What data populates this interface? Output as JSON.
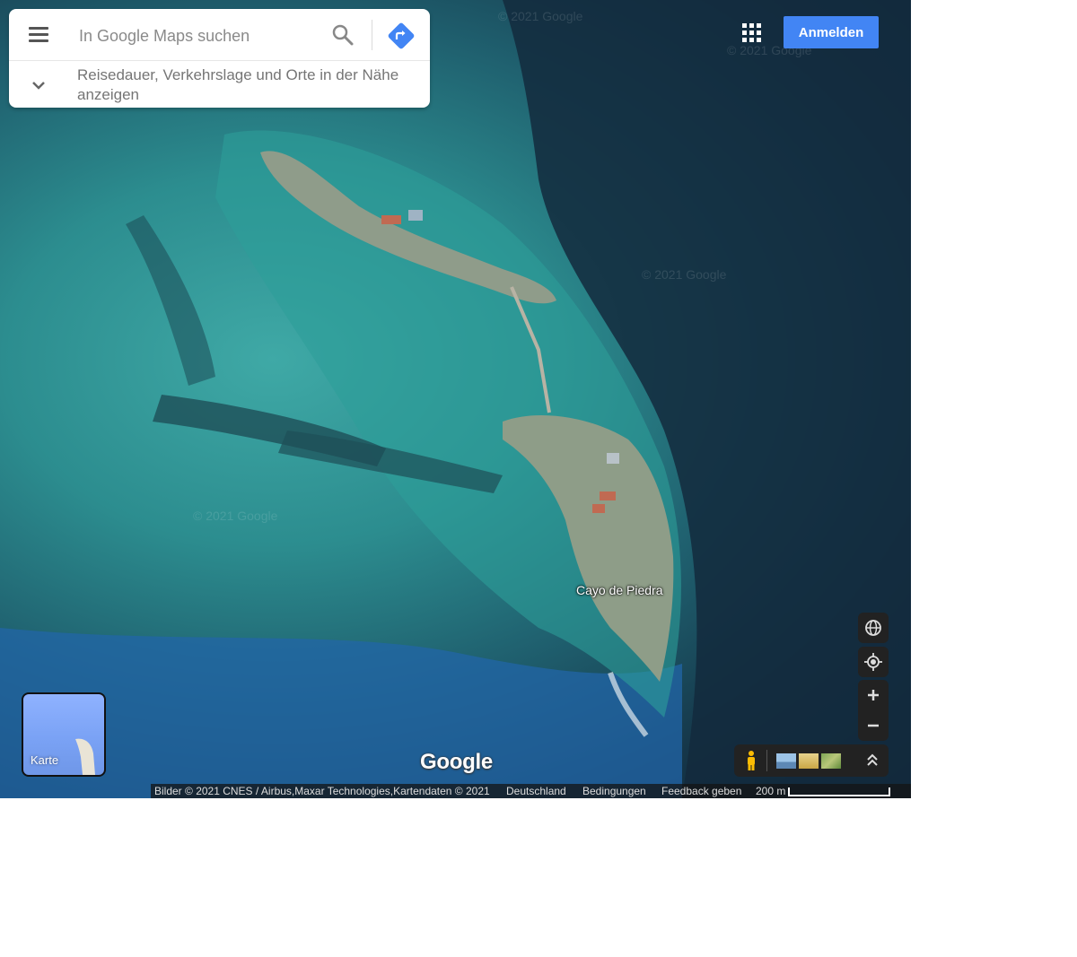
{
  "search": {
    "placeholder": "In Google Maps suchen",
    "expand_text": "Reisedauer, Verkehrslage und Orte in der Nähe anzeigen"
  },
  "header": {
    "signin_label": "Anmelden"
  },
  "map": {
    "place_label": "Cayo de Piedra",
    "watermark": "© 2021 Google",
    "logo": "Google"
  },
  "layer_switcher": {
    "label": "Karte"
  },
  "footer": {
    "attribution": "Bilder © 2021 CNES / Airbus,Maxar Technologies,Kartendaten © 2021",
    "country": "Deutschland",
    "terms": "Bedingungen",
    "feedback": "Feedback geben",
    "scale": "200 m"
  },
  "icons": {
    "menu": "hamburger-menu-icon",
    "search": "search-icon",
    "directions": "directions-icon",
    "apps": "apps-grid-icon",
    "globe": "globe-icon",
    "location": "my-location-icon",
    "zoom_in": "plus-icon",
    "zoom_out": "minus-icon",
    "pegman": "pegman-icon",
    "expand": "chevron-up-double-icon",
    "chevron": "chevron-down-icon"
  },
  "colors": {
    "signin_button": "#4285f4",
    "directions_icon": "#4285f4",
    "pegman": "#fbbc04"
  }
}
